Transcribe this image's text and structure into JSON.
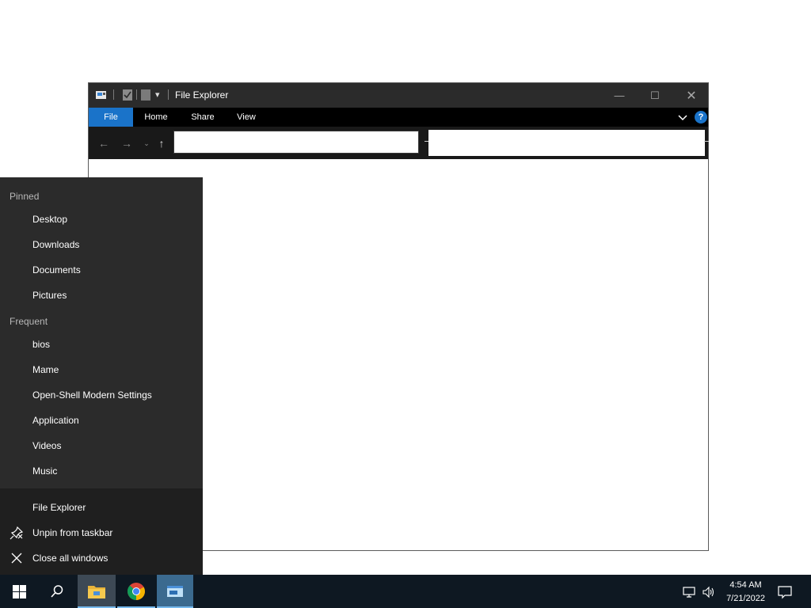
{
  "window": {
    "title": "File Explorer",
    "controls": {
      "minimize": "minimize-icon",
      "maximize": "maximize-icon",
      "close": "close-icon"
    }
  },
  "ribbon": {
    "tabs": [
      {
        "label": "File",
        "active": true
      },
      {
        "label": "Home",
        "active": false
      },
      {
        "label": "Share",
        "active": false
      },
      {
        "label": "View",
        "active": false
      }
    ],
    "help_label": "?"
  },
  "addressbar": {
    "value": "",
    "search_value": ""
  },
  "jumplist": {
    "pinned_header": "Pinned",
    "pinned": [
      "Desktop",
      "Downloads",
      "Documents",
      "Pictures"
    ],
    "frequent_header": "Frequent",
    "frequent": [
      "bios",
      "Mame",
      "Open-Shell Modern Settings",
      "Application",
      "Videos",
      "Music"
    ],
    "tasks": [
      {
        "label": "File Explorer",
        "icon": "file-explorer-icon"
      },
      {
        "label": "Unpin from taskbar",
        "icon": "unpin-icon"
      },
      {
        "label": "Close all windows",
        "icon": "close-icon"
      }
    ]
  },
  "taskbar": {
    "time": "4:54 AM",
    "date": "7/21/2022",
    "accent": "#76b9ed"
  },
  "colors": {
    "ribbon_active": "#1a73c9",
    "titlebar": "#2b2b2b",
    "jumplist_bg": "#2b2b2b"
  }
}
